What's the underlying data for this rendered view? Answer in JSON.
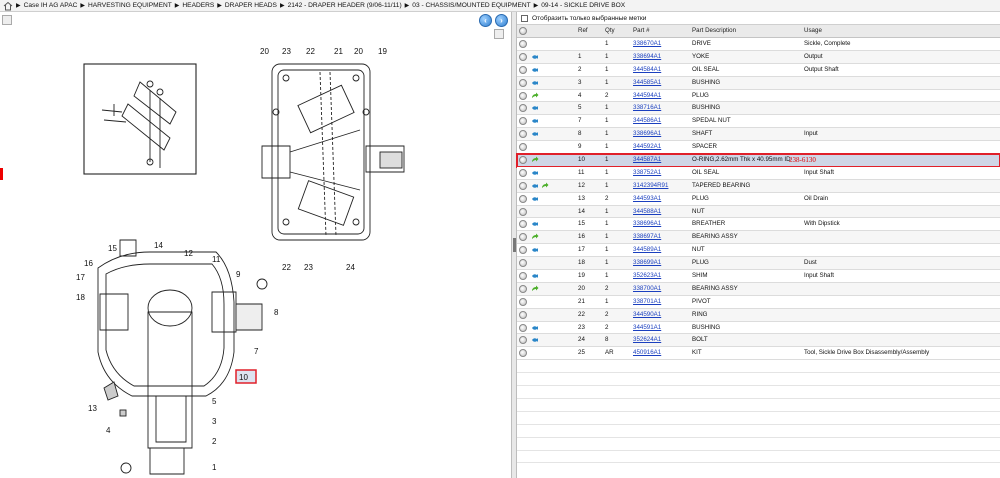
{
  "breadcrumb": [
    "Case IH AG APAC",
    "HARVESTING EQUIPMENT",
    "HEADERS",
    "DRAPER HEADS",
    "2142 - DRAPER HEADER (9/06-11/11)",
    "03 - CHASSIS/MOUNTED EQUIPMENT",
    "09-14 - SICKLE DRIVE BOX"
  ],
  "filter": {
    "label": "Отобразить только выбранные метки"
  },
  "columns": {
    "ref": "Ref",
    "qty": "Qty",
    "part": "Part #",
    "desc": "Part Description",
    "usage": "Usage"
  },
  "parts": [
    {
      "ref": "",
      "qty": "1",
      "part": "338670A1",
      "desc": "DRIVE",
      "usage": "Sickle, Complete",
      "icons": []
    },
    {
      "ref": "1",
      "qty": "1",
      "part": "338694A1",
      "desc": "YOKE",
      "usage": "Output",
      "icons": [
        "fish-icon"
      ]
    },
    {
      "ref": "2",
      "qty": "1",
      "part": "344584A1",
      "desc": "OIL SEAL",
      "usage": "Output Shaft",
      "icons": [
        "fish-icon"
      ]
    },
    {
      "ref": "3",
      "qty": "1",
      "part": "344585A1",
      "desc": "BUSHING",
      "usage": "",
      "icons": [
        "fish-icon"
      ]
    },
    {
      "ref": "4",
      "qty": "2",
      "part": "344594A1",
      "desc": "PLUG",
      "usage": "",
      "icons": [
        "arrow-icon"
      ]
    },
    {
      "ref": "5",
      "qty": "1",
      "part": "338716A1",
      "desc": "BUSHING",
      "usage": "",
      "icons": [
        "fish-icon"
      ]
    },
    {
      "ref": "7",
      "qty": "1",
      "part": "344586A1",
      "desc": "SPEDAL NUT",
      "usage": "",
      "icons": [
        "fish-icon"
      ]
    },
    {
      "ref": "8",
      "qty": "1",
      "part": "338696A1",
      "desc": "SHAFT",
      "usage": "Input",
      "icons": [
        "fish-icon"
      ]
    },
    {
      "ref": "9",
      "qty": "1",
      "part": "344592A1",
      "desc": "SPACER",
      "usage": "",
      "icons": []
    },
    {
      "ref": "10",
      "qty": "1",
      "part": "344587A1",
      "desc": "O-RING,2.62mm Thk x 40.95mm ID",
      "usage": "",
      "note": "238-6130",
      "icons": [
        "arrow-icon"
      ],
      "selected": true
    },
    {
      "ref": "11",
      "qty": "1",
      "part": "338752A1",
      "desc": "OIL SEAL",
      "usage": "Input Shaft",
      "icons": [
        "fish-icon"
      ]
    },
    {
      "ref": "12",
      "qty": "1",
      "part": "3142394R91",
      "desc": "TAPERED BEARING",
      "usage": "",
      "icons": [
        "fish-icon",
        "arrow-icon"
      ]
    },
    {
      "ref": "13",
      "qty": "2",
      "part": "344593A1",
      "desc": "PLUG",
      "usage": "Oil Drain",
      "icons": [
        "fish-icon"
      ]
    },
    {
      "ref": "14",
      "qty": "1",
      "part": "344588A1",
      "desc": "NUT",
      "usage": "",
      "icons": []
    },
    {
      "ref": "15",
      "qty": "1",
      "part": "338696A1",
      "desc": "BREATHER",
      "usage": "With Dipstick",
      "icons": [
        "fish-icon"
      ]
    },
    {
      "ref": "16",
      "qty": "1",
      "part": "338697A1",
      "desc": "BEARING ASSY",
      "usage": "",
      "icons": [
        "arrow-icon"
      ]
    },
    {
      "ref": "17",
      "qty": "1",
      "part": "344589A1",
      "desc": "NUT",
      "usage": "",
      "icons": [
        "fish-icon"
      ]
    },
    {
      "ref": "18",
      "qty": "1",
      "part": "338699A1",
      "desc": "PLUG",
      "usage": "Dust",
      "icons": []
    },
    {
      "ref": "19",
      "qty": "1",
      "part": "352623A1",
      "desc": "SHIM",
      "usage": "Input Shaft",
      "icons": [
        "fish-icon"
      ]
    },
    {
      "ref": "20",
      "qty": "2",
      "part": "338700A1",
      "desc": "BEARING ASSY",
      "usage": "",
      "icons": [
        "arrow-icon"
      ]
    },
    {
      "ref": "21",
      "qty": "1",
      "part": "338701A1",
      "desc": "PIVOT",
      "usage": "",
      "icons": []
    },
    {
      "ref": "22",
      "qty": "2",
      "part": "344590A1",
      "desc": "RING",
      "usage": "",
      "icons": []
    },
    {
      "ref": "23",
      "qty": "2",
      "part": "344591A1",
      "desc": "BUSHING",
      "usage": "",
      "icons": [
        "fish-icon"
      ]
    },
    {
      "ref": "24",
      "qty": "8",
      "part": "352624A1",
      "desc": "BOLT",
      "usage": "",
      "icons": [
        "fish-icon"
      ]
    },
    {
      "ref": "25",
      "qty": "AR",
      "part": "450916A1",
      "desc": "KIT",
      "usage": "Tool, Sickle Drive Box Disassembly/Assembly",
      "icons": []
    }
  ],
  "drawing": {
    "top_callouts": [
      "20",
      "23",
      "22",
      "21",
      "20",
      "19",
      "22",
      "23",
      "24"
    ],
    "bottom_callouts": [
      "15",
      "14",
      "12",
      "11",
      "16",
      "17",
      "9",
      "18",
      "8",
      "7",
      "10",
      "5",
      "3",
      "2",
      "1",
      "13",
      "4"
    ],
    "highlighted_callout": "10"
  },
  "colors": {
    "selected_row": "#cfd6e6",
    "highlight": "#e0202a",
    "link": "#1a3fbf"
  }
}
